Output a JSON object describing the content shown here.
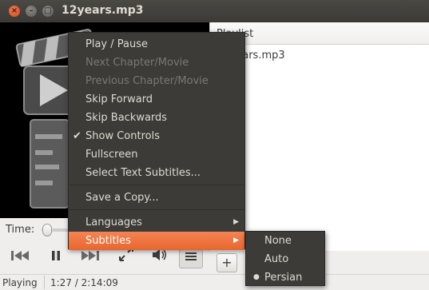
{
  "window": {
    "title": "12years.mp3"
  },
  "playlist": {
    "header": "Playlist",
    "items": [
      "12years.mp3"
    ]
  },
  "time": {
    "label": "Time:",
    "position_fraction": 0.01
  },
  "status": {
    "state": "Playing",
    "time": "1:27 / 2:14:09"
  },
  "context_menu": {
    "items": [
      {
        "label": "Play / Pause",
        "enabled": true
      },
      {
        "label": "Next Chapter/Movie",
        "enabled": false
      },
      {
        "label": "Previous Chapter/Movie",
        "enabled": false
      },
      {
        "label": "Skip Forward",
        "enabled": true
      },
      {
        "label": "Skip Backwards",
        "enabled": true
      },
      {
        "label": "Show Controls",
        "enabled": true,
        "checked": true
      },
      {
        "label": "Fullscreen",
        "enabled": true
      },
      {
        "label": "Select Text Subtitles...",
        "enabled": true
      },
      {
        "label": "Save a Copy...",
        "enabled": true
      },
      {
        "label": "Languages",
        "enabled": true,
        "submenu": true
      },
      {
        "label": "Subtitles",
        "enabled": true,
        "submenu": true,
        "active": true
      }
    ]
  },
  "subtitles_menu": {
    "items": [
      {
        "label": "None",
        "selected": false
      },
      {
        "label": "Auto",
        "selected": false
      },
      {
        "label": "Persian",
        "selected": true
      }
    ]
  },
  "icons": {
    "close": "close-icon",
    "minimize": "minimize-icon",
    "maximize": "maximize-icon",
    "prev": "skip-back-icon",
    "pause": "pause-icon",
    "next": "skip-forward-icon",
    "fullscreen": "fullscreen-icon",
    "volume": "volume-icon",
    "menu": "menu-icon",
    "add": "add-icon"
  },
  "colors": {
    "menu_bg": "#3c3b37",
    "accent": "#e8662e",
    "titlebar": "#3b3a36"
  }
}
